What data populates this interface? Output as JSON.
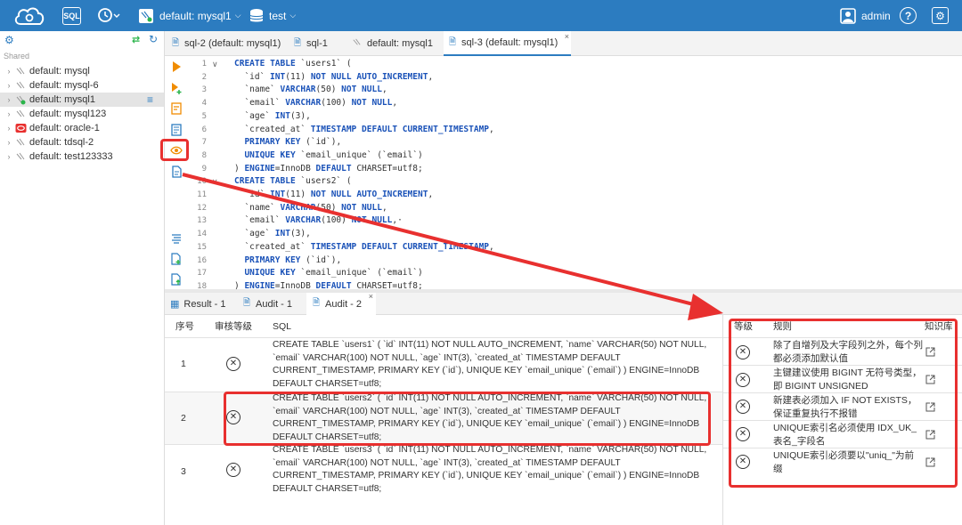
{
  "topbar": {
    "sql_badge": "SQL",
    "connection": "default: mysql1",
    "database": "test",
    "user": "admin",
    "help": "?"
  },
  "sidebar": {
    "shared_label": "Shared",
    "items": [
      {
        "label": "default: mysql"
      },
      {
        "label": "default: mysql-6"
      },
      {
        "label": "default: mysql1"
      },
      {
        "label": "default: mysql123"
      },
      {
        "label": "default: oracle-1"
      },
      {
        "label": "default: tdsql-2"
      },
      {
        "label": "default: test123333"
      }
    ]
  },
  "editor_tabs": [
    {
      "label": "sql-2 (default: mysql1)"
    },
    {
      "label": "sql-1"
    },
    {
      "label": "default: mysql1"
    },
    {
      "label": "sql-3 (default: mysql1)"
    }
  ],
  "editor": {
    "line_numbers": [
      "1",
      "2",
      "3",
      "4",
      "5",
      "6",
      "7",
      "8",
      "9",
      "10",
      "11",
      "12",
      "13",
      "14",
      "15",
      "16",
      "17",
      "18"
    ],
    "lines": [
      "CREATE TABLE `users1` (",
      "  `id` INT(11) NOT NULL AUTO_INCREMENT,",
      "  `name` VARCHAR(50) NOT NULL,",
      "  `email` VARCHAR(100) NOT NULL,",
      "  `age` INT(3),",
      "  `created_at` TIMESTAMP DEFAULT CURRENT_TIMESTAMP,",
      "  PRIMARY KEY (`id`),",
      "  UNIQUE KEY `email_unique` (`email`)",
      ") ENGINE=InnoDB DEFAULT CHARSET=utf8;",
      "CREATE TABLE `users2` (",
      "  `id` INT(11) NOT NULL AUTO_INCREMENT,",
      "  `name` VARCHAR(50) NOT NULL,",
      "  `email` VARCHAR(100) NOT NULL,·",
      "  `age` INT(3),",
      "  `created_at` TIMESTAMP DEFAULT CURRENT_TIMESTAMP,",
      "  PRIMARY KEY (`id`),",
      "  UNIQUE KEY `email_unique` (`email`)",
      ") ENGINE=InnoDB DEFAULT CHARSET=utf8;"
    ]
  },
  "result_tabs": [
    {
      "label": "Result - 1"
    },
    {
      "label": "Audit - 1"
    },
    {
      "label": "Audit - 2"
    }
  ],
  "audit_grid": {
    "headers": {
      "no": "序号",
      "level": "审核等级",
      "sql": "SQL"
    },
    "rows": [
      {
        "no": "1",
        "sql": "CREATE TABLE `users1` ( `id` INT(11) NOT NULL AUTO_INCREMENT, `name` VARCHAR(50) NOT NULL, `email` VARCHAR(100) NOT NULL, `age` INT(3), `created_at` TIMESTAMP DEFAULT CURRENT_TIMESTAMP, PRIMARY KEY (`id`), UNIQUE KEY `email_unique` (`email`) ) ENGINE=InnoDB DEFAULT CHARSET=utf8;"
      },
      {
        "no": "2",
        "sql": "CREATE TABLE `users2` ( `id` INT(11) NOT NULL AUTO_INCREMENT, `name` VARCHAR(50) NOT NULL, `email` VARCHAR(100) NOT NULL, `age` INT(3), `created_at` TIMESTAMP DEFAULT CURRENT_TIMESTAMP, PRIMARY KEY (`id`), UNIQUE KEY `email_unique` (`email`) ) ENGINE=InnoDB DEFAULT CHARSET=utf8;"
      },
      {
        "no": "3",
        "sql": "CREATE TABLE `users3` ( `id` INT(11) NOT NULL AUTO_INCREMENT, `name` VARCHAR(50) NOT NULL, `email` VARCHAR(100) NOT NULL, `age` INT(3), `created_at` TIMESTAMP DEFAULT CURRENT_TIMESTAMP, PRIMARY KEY (`id`), UNIQUE KEY `email_unique` (`email`) ) ENGINE=InnoDB DEFAULT CHARSET=utf8;"
      }
    ]
  },
  "rules_panel": {
    "headers": {
      "level": "等级",
      "rule": "规则",
      "kb": "知识库"
    },
    "rules": [
      {
        "text": "除了自增列及大字段列之外，每个列都必须添加默认值"
      },
      {
        "text": "主键建议使用 BIGINT 无符号类型，即 BIGINT UNSIGNED"
      },
      {
        "text": "新建表必须加入 IF NOT EXISTS，保证重复执行不报错"
      },
      {
        "text": "UNIQUE索引名必须使用 IDX_UK_表名_字段名"
      },
      {
        "text": "UNIQUE索引必须要以\"uniq_\"为前缀"
      }
    ]
  },
  "colors": {
    "topbar": "#2c7cc0",
    "keyword": "#1a52b8",
    "highlight_red": "#e8302f",
    "run_orange": "#f08c00"
  },
  "icons": [
    "cloud-logo-icon",
    "history-icon",
    "database-icon",
    "user-icon",
    "help-icon",
    "settings-icon",
    "gear-icon",
    "refresh-icon",
    "run-icon",
    "explain-icon",
    "format-icon",
    "audit-eye-icon",
    "document-icon",
    "open-external-icon",
    "error-circle-icon"
  ]
}
